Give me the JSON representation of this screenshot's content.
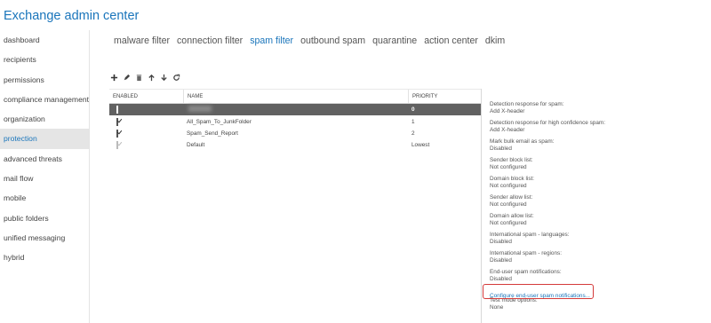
{
  "app": {
    "title": "Exchange admin center"
  },
  "sidebar": {
    "items": [
      {
        "label": "dashboard",
        "active": false
      },
      {
        "label": "recipients",
        "active": false
      },
      {
        "label": "permissions",
        "active": false
      },
      {
        "label": "compliance management",
        "active": false
      },
      {
        "label": "organization",
        "active": false
      },
      {
        "label": "protection",
        "active": true
      },
      {
        "label": "advanced threats",
        "active": false
      },
      {
        "label": "mail flow",
        "active": false
      },
      {
        "label": "mobile",
        "active": false
      },
      {
        "label": "public folders",
        "active": false
      },
      {
        "label": "unified messaging",
        "active": false
      },
      {
        "label": "hybrid",
        "active": false
      }
    ]
  },
  "tabs": [
    {
      "label": "malware filter",
      "active": false
    },
    {
      "label": "connection filter",
      "active": false
    },
    {
      "label": "spam filter",
      "active": true
    },
    {
      "label": "outbound spam",
      "active": false
    },
    {
      "label": "quarantine",
      "active": false
    },
    {
      "label": "action center",
      "active": false
    },
    {
      "label": "dkim",
      "active": false
    }
  ],
  "toolbar": {
    "icons": [
      "add-icon",
      "edit-icon",
      "delete-icon",
      "move-up-icon",
      "move-down-icon",
      "refresh-icon"
    ]
  },
  "grid": {
    "headers": {
      "enabled": "ENABLED",
      "name": "NAME",
      "priority": "PRIORITY"
    },
    "rows": [
      {
        "name": "",
        "priority": "0",
        "checked": true,
        "selected": true,
        "blurred": true
      },
      {
        "name": "All_Spam_To_JunkFolder",
        "priority": "1",
        "checked": true,
        "selected": false
      },
      {
        "name": "Spam_Send_Report",
        "priority": "2",
        "checked": true,
        "selected": false
      },
      {
        "name": "Default",
        "priority": "Lowest",
        "checked": true,
        "selected": false,
        "disabled": true
      }
    ]
  },
  "details": {
    "items": [
      {
        "label": "Detection response for spam:",
        "value": "Add X-header"
      },
      {
        "label": "Detection response for high confidence spam:",
        "value": "Add X-header"
      },
      {
        "label": "Mark bulk email as spam:",
        "value": "Disabled"
      },
      {
        "label": "Sender block list:",
        "value": "Not configured"
      },
      {
        "label": "Domain block list:",
        "value": "Not configured"
      },
      {
        "label": "Sender allow list:",
        "value": "Not configured"
      },
      {
        "label": "Domain allow list:",
        "value": "Not configured"
      },
      {
        "label": "International spam - languages:",
        "value": "Disabled"
      },
      {
        "label": "International spam - regions:",
        "value": "Disabled"
      },
      {
        "label": "End-user spam notifications:",
        "value": "Disabled"
      }
    ],
    "link": "Configure end-user spam notifications...",
    "test_mode": {
      "label": "Test mode options:",
      "value": "None"
    }
  },
  "colors": {
    "accent": "#1a75bb",
    "selected_row": "#616161",
    "highlight_box": "#d43a3a"
  }
}
